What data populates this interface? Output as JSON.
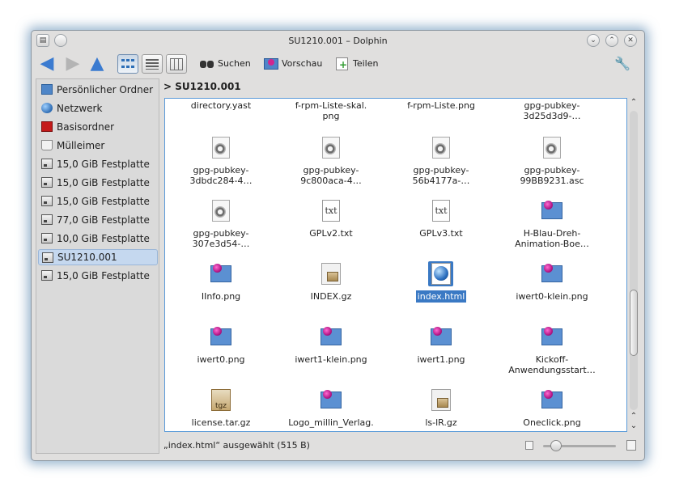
{
  "window": {
    "title": "SU1210.001 – Dolphin"
  },
  "toolbar": {
    "search_label": "Suchen",
    "preview_label": "Vorschau",
    "split_label": "Teilen"
  },
  "places": [
    {
      "label": "Persönlicher Ordner",
      "icon": "home-folder-icon"
    },
    {
      "label": "Netzwerk",
      "icon": "network-icon"
    },
    {
      "label": "Basisordner",
      "icon": "root-folder-icon"
    },
    {
      "label": "Mülleimer",
      "icon": "trash-icon"
    },
    {
      "label": "15,0 GiB Festplatte",
      "icon": "hard-disk-icon"
    },
    {
      "label": "15,0 GiB Festplatte",
      "icon": "hard-disk-icon"
    },
    {
      "label": "15,0 GiB Festplatte",
      "icon": "hard-disk-icon"
    },
    {
      "label": "77,0 GiB Festplatte",
      "icon": "hard-disk-icon"
    },
    {
      "label": "10,0 GiB Festplatte",
      "icon": "hard-disk-icon"
    },
    {
      "label": "SU1210.001",
      "icon": "hard-disk-icon",
      "selected": true
    },
    {
      "label": "15,0 GiB Festplatte",
      "icon": "hard-disk-icon"
    }
  ],
  "breadcrumb": {
    "separator": ">",
    "current": "SU1210.001"
  },
  "files": [
    {
      "l1": "directory.yast",
      "l2": "",
      "type": "none"
    },
    {
      "l1": "f-rpm-Liste-skal.",
      "l2": "png",
      "type": "none"
    },
    {
      "l1": "f-rpm-Liste.png",
      "l2": "",
      "type": "none"
    },
    {
      "l1": "gpg-pubkey-",
      "l2": "3d25d3d9-…",
      "type": "none"
    },
    {
      "l1": "gpg-pubkey-",
      "l2": "3dbdc284-4…",
      "type": "key"
    },
    {
      "l1": "gpg-pubkey-",
      "l2": "9c800aca-4…",
      "type": "key"
    },
    {
      "l1": "gpg-pubkey-",
      "l2": "56b4177a-…",
      "type": "key"
    },
    {
      "l1": "gpg-pubkey-",
      "l2": "99BB9231.asc",
      "type": "key"
    },
    {
      "l1": "gpg-pubkey-",
      "l2": "307e3d54-…",
      "type": "key"
    },
    {
      "l1": "GPLv2.txt",
      "l2": "",
      "type": "txt"
    },
    {
      "l1": "GPLv3.txt",
      "l2": "",
      "type": "txt"
    },
    {
      "l1": "H-Blau-Dreh-",
      "l2": "Animation-Boe…",
      "type": "png"
    },
    {
      "l1": "IInfo.png",
      "l2": "",
      "type": "png"
    },
    {
      "l1": "INDEX.gz",
      "l2": "",
      "type": "gz"
    },
    {
      "l1": "index.html",
      "l2": "",
      "type": "html",
      "selected": true
    },
    {
      "l1": "iwert0-klein.png",
      "l2": "",
      "type": "png"
    },
    {
      "l1": "iwert0.png",
      "l2": "",
      "type": "png"
    },
    {
      "l1": "iwert1-klein.png",
      "l2": "",
      "type": "png"
    },
    {
      "l1": "iwert1.png",
      "l2": "",
      "type": "png"
    },
    {
      "l1": "Kickoff-",
      "l2": "Anwendungsstart…",
      "type": "png"
    },
    {
      "l1": "license.tar.gz",
      "l2": "",
      "type": "tgz"
    },
    {
      "l1": "Logo_millin_Verlag.",
      "l2": "png",
      "type": "png"
    },
    {
      "l1": "ls-lR.gz",
      "l2": "",
      "type": "gz"
    },
    {
      "l1": "Oneclick.png",
      "l2": "",
      "type": "png"
    }
  ],
  "status": {
    "text": "„index.html“ ausgewählt (515 B)"
  },
  "zoom": {
    "level": 0.12
  }
}
